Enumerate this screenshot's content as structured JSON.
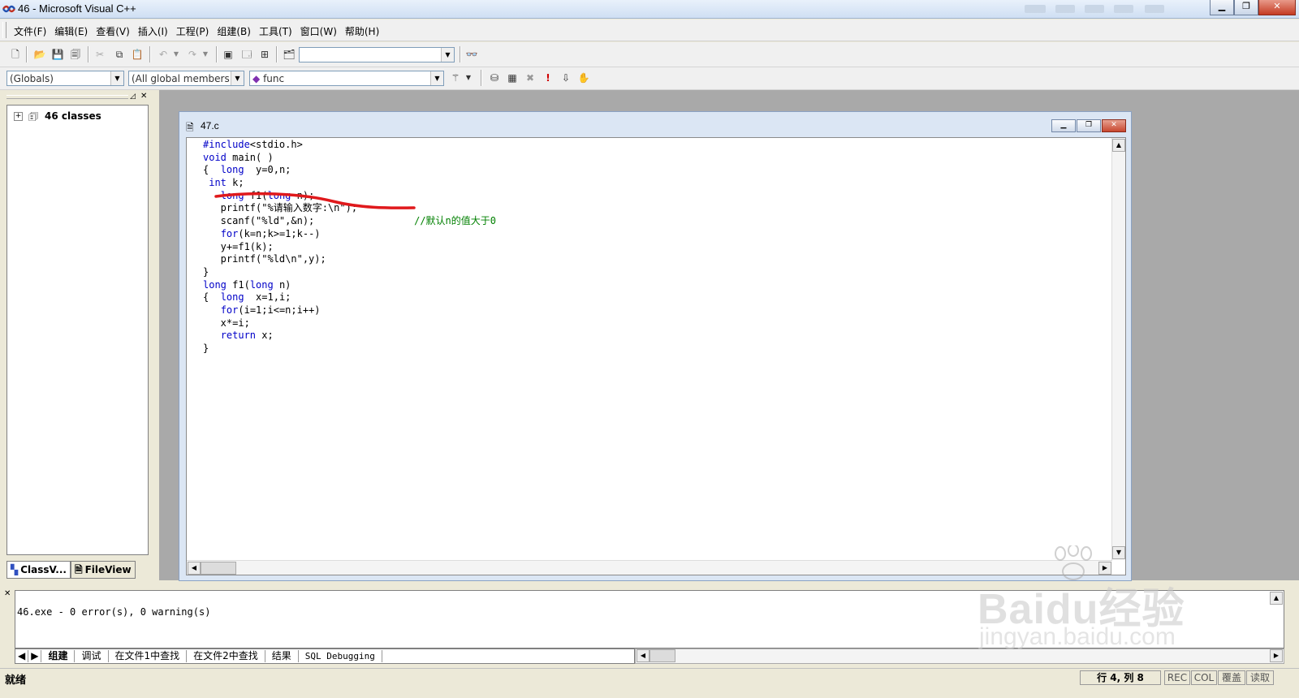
{
  "window": {
    "title": "46 - Microsoft Visual C++"
  },
  "menu": [
    "文件(F)",
    "编辑(E)",
    "查看(V)",
    "插入(I)",
    "工程(P)",
    "组建(B)",
    "工具(T)",
    "窗口(W)",
    "帮助(H)"
  ],
  "wizardbar": {
    "class_combo": "(Globals)",
    "filter_combo": "(All global members",
    "member_combo": "func"
  },
  "workspace": {
    "tree_root": "46 classes",
    "tabs": [
      "ClassV...",
      "FileView"
    ]
  },
  "document": {
    "title": "47.c",
    "code": [
      [
        {
          "t": "#include",
          "k": 1
        },
        {
          "t": "<stdio.h>"
        }
      ],
      [
        {
          "t": "void",
          "k": 1
        },
        {
          "t": " main( )"
        }
      ],
      [
        {
          "t": "{  "
        },
        {
          "t": "long",
          "k": 1
        },
        {
          "t": "  y=0,n;"
        }
      ],
      [
        {
          "t": " "
        },
        {
          "t": "int",
          "k": 1
        },
        {
          "t": " k;"
        }
      ],
      [
        {
          "t": "   "
        },
        {
          "t": "long",
          "k": 1
        },
        {
          "t": " f1("
        },
        {
          "t": "long",
          "k": 1
        },
        {
          "t": " n);"
        }
      ],
      [
        {
          "t": "   printf(\"%请输入数字:\\n\");"
        }
      ],
      [
        {
          "t": "   scanf(\"%ld\",&n);                 "
        },
        {
          "t": "//默认n的值大于0",
          "c": 1
        }
      ],
      [
        {
          "t": "   "
        },
        {
          "t": "for",
          "k": 1
        },
        {
          "t": "(k=n;k>=1;k--)"
        }
      ],
      [
        {
          "t": "   y+=f1(k);"
        }
      ],
      [
        {
          "t": "   printf(\"%ld\\n\",y);"
        }
      ],
      [
        {
          "t": "}"
        }
      ],
      [
        {
          "t": "long",
          "k": 1
        },
        {
          "t": " f1("
        },
        {
          "t": "long",
          "k": 1
        },
        {
          "t": " n)"
        }
      ],
      [
        {
          "t": "{  "
        },
        {
          "t": "long",
          "k": 1
        },
        {
          "t": "  x=1,i;"
        }
      ],
      [
        {
          "t": "   "
        },
        {
          "t": "for",
          "k": 1
        },
        {
          "t": "(i=1;i<=n;i++)"
        }
      ],
      [
        {
          "t": "   x*=i;"
        }
      ],
      [
        {
          "t": "   "
        },
        {
          "t": "return",
          "k": 1
        },
        {
          "t": " x;"
        }
      ],
      [
        {
          "t": "}"
        }
      ]
    ]
  },
  "output": {
    "text": "46.exe - 0 error(s), 0 warning(s)",
    "tabs": [
      "组建",
      "调试",
      "在文件1中查找",
      "在文件2中查找",
      "结果",
      "SQL Debugging"
    ]
  },
  "status": {
    "text": "就绪",
    "position": "行 4, 列 8",
    "indicators": [
      "REC",
      "COL",
      "覆盖",
      "读取"
    ]
  },
  "annotation_color": "#e0191c",
  "watermark": {
    "brand": "Baidu经验",
    "url": "jingyan.baidu.com"
  }
}
